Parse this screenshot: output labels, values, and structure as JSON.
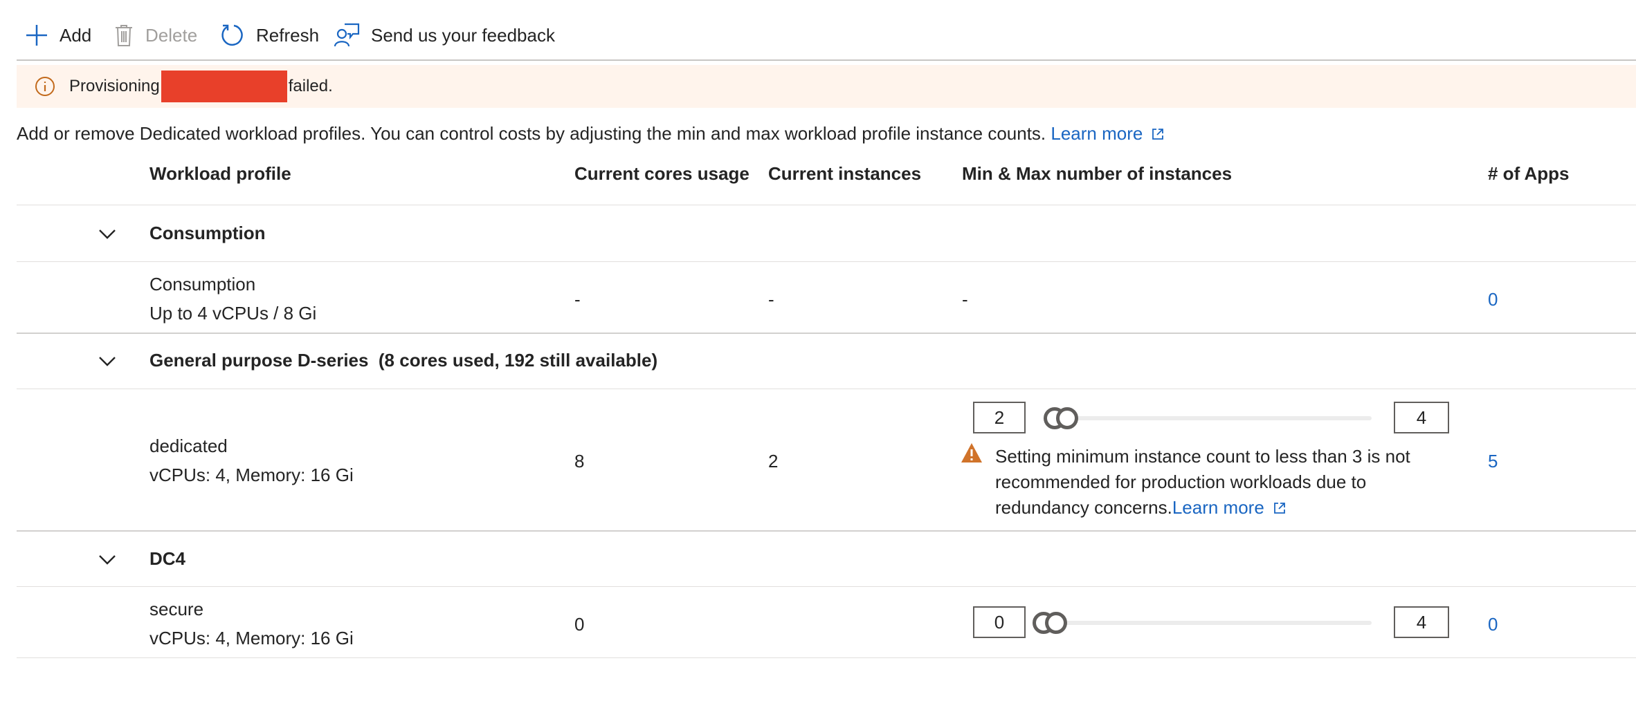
{
  "toolbar": {
    "add_label": "Add",
    "delete_label": "Delete",
    "refresh_label": "Refresh",
    "feedback_label": "Send us your feedback"
  },
  "banner": {
    "prefix": "Provisioning",
    "suffix": "failed."
  },
  "description": {
    "text": "Add or remove Dedicated workload profiles. You can control costs by adjusting the min and max workload profile instance counts.",
    "link": "Learn more"
  },
  "table": {
    "headers": {
      "profile": "Workload profile",
      "cores": "Current cores usage",
      "instances": "Current instances",
      "minmax": "Min & Max number of instances",
      "apps": "# of Apps"
    },
    "groups": [
      {
        "name": "Consumption",
        "rows": [
          {
            "name": "Consumption",
            "spec": "Up to 4 vCPUs / 8 Gi",
            "cores": "-",
            "instances": "-",
            "minmax": "-",
            "apps": "0"
          }
        ]
      },
      {
        "name": "General purpose D-series  (8 cores used, 192 still available)",
        "rows": [
          {
            "name": "dedicated",
            "spec": "vCPUs: 4, Memory: 16 Gi",
            "cores": "8",
            "instances": "2",
            "min": "2",
            "max": "4",
            "apps": "5",
            "slider": {
              "range": [
                0,
                4
              ],
              "low": 0,
              "high": 0
            },
            "warning": "Setting minimum instance count to less than 3 is not recommended for production workloads due to redundancy concerns.",
            "warning_link": "Learn more"
          }
        ]
      },
      {
        "name": "DC4",
        "rows": [
          {
            "name": "secure",
            "spec": "vCPUs: 4, Memory: 16 Gi",
            "cores": "0",
            "min": "0",
            "max": "4",
            "apps": "0",
            "slider": {
              "range": [
                0,
                4
              ],
              "low": 0,
              "high": 0
            }
          }
        ]
      }
    ]
  },
  "colors": {
    "link": "#1a66c2",
    "banner_bg": "#fff4ec",
    "redaction": "#e8402a",
    "info_icon": "#c2691b",
    "warning_icon": "#d0732a"
  }
}
